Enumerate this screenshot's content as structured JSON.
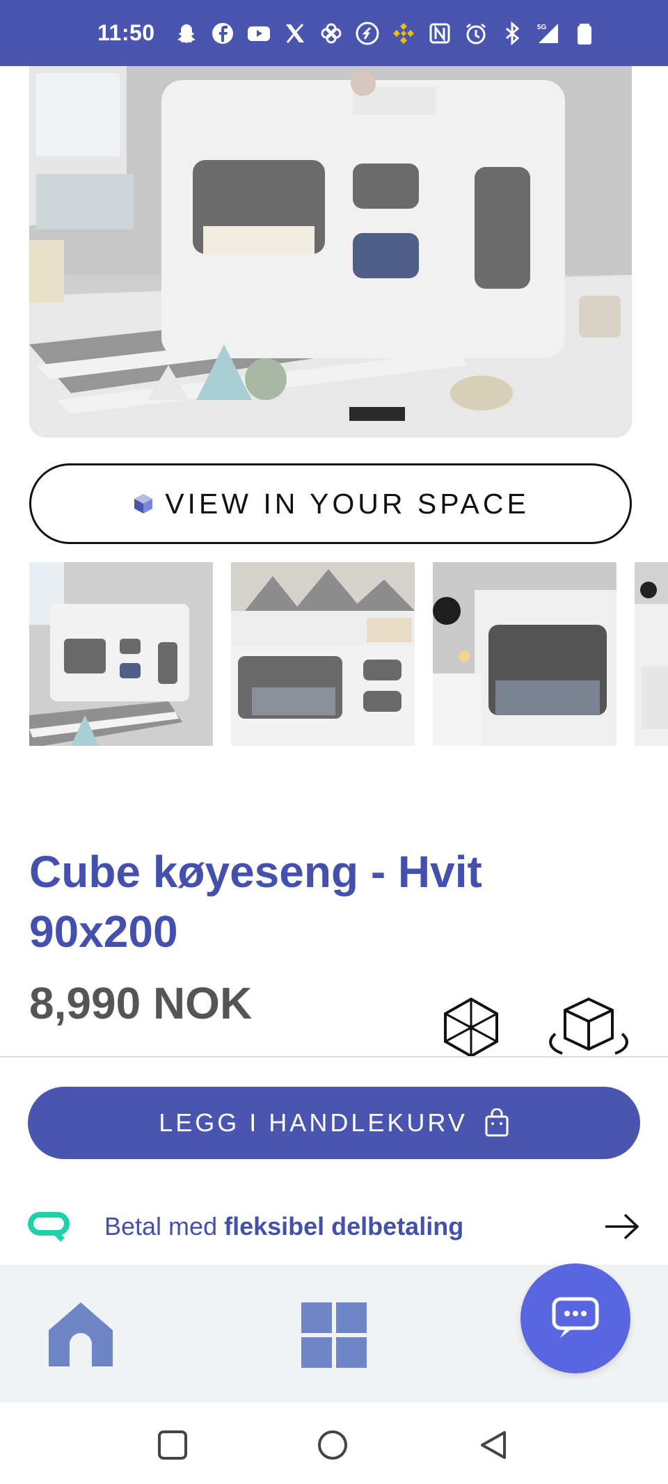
{
  "status_bar": {
    "time": "11:50",
    "icons": [
      "snapchat-icon",
      "facebook-icon",
      "youtube-icon",
      "x-icon",
      "pinwheel-icon",
      "shazam-icon",
      "binance-icon",
      "nfc-icon",
      "alarm-icon",
      "bluetooth-icon",
      "signal-5g-icon",
      "battery-icon"
    ],
    "network": "5G"
  },
  "product": {
    "view_in_space_label": "VIEW IN YOUR SPACE",
    "title": "Cube køyeseng - Hvit 90x200",
    "price": "8,990 NOK",
    "thumbnail_count": 4
  },
  "purchase": {
    "add_to_cart_label": "LEGG I HANDLEKURV",
    "financing_prefix": "Betal med ",
    "financing_bold": "fleksibel delbetaling"
  },
  "colors": {
    "brand": "#4a55b0",
    "title": "#4450ad",
    "price": "#555555",
    "chat_fab": "#5a66e0",
    "financing_logo": "#1fd1a8",
    "nav_icons": "#6f86c6"
  },
  "nav": {
    "items": [
      "home-icon",
      "categories-grid-icon",
      "chat-icon"
    ]
  }
}
